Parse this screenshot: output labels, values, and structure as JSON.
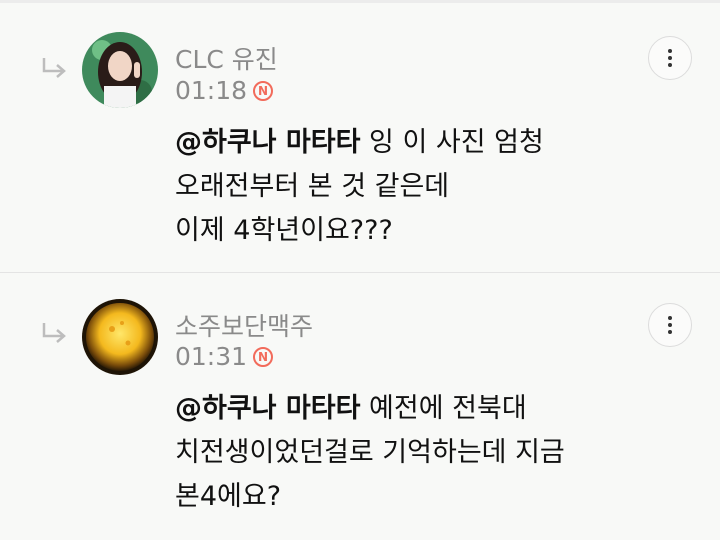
{
  "comments": [
    {
      "author": "CLC 유진",
      "time": "01:18",
      "badge": "N",
      "mention": "@하쿠나 마타타",
      "lines": [
        "잉 이 사진 엄청",
        "오래전부터 본 것 같은데",
        "이제 4학년이요???"
      ]
    },
    {
      "author": "소주보단맥주",
      "time": "01:31",
      "badge": "N",
      "mention": "@하쿠나 마타타",
      "lines": [
        "예전에 전북대",
        "치전생이었던걸로 기억하는데 지금",
        "본4에요?"
      ]
    }
  ],
  "icons": {
    "reply": "reply-arrow-icon",
    "more": "more-vertical-icon",
    "new_badge": "new-badge-icon"
  },
  "colors": {
    "background": "#f8f9f7",
    "meta_text": "#8a8a8a",
    "body_text": "#111111",
    "new_badge": "#f26b5b",
    "reply_arrow": "#bdbdbd"
  }
}
